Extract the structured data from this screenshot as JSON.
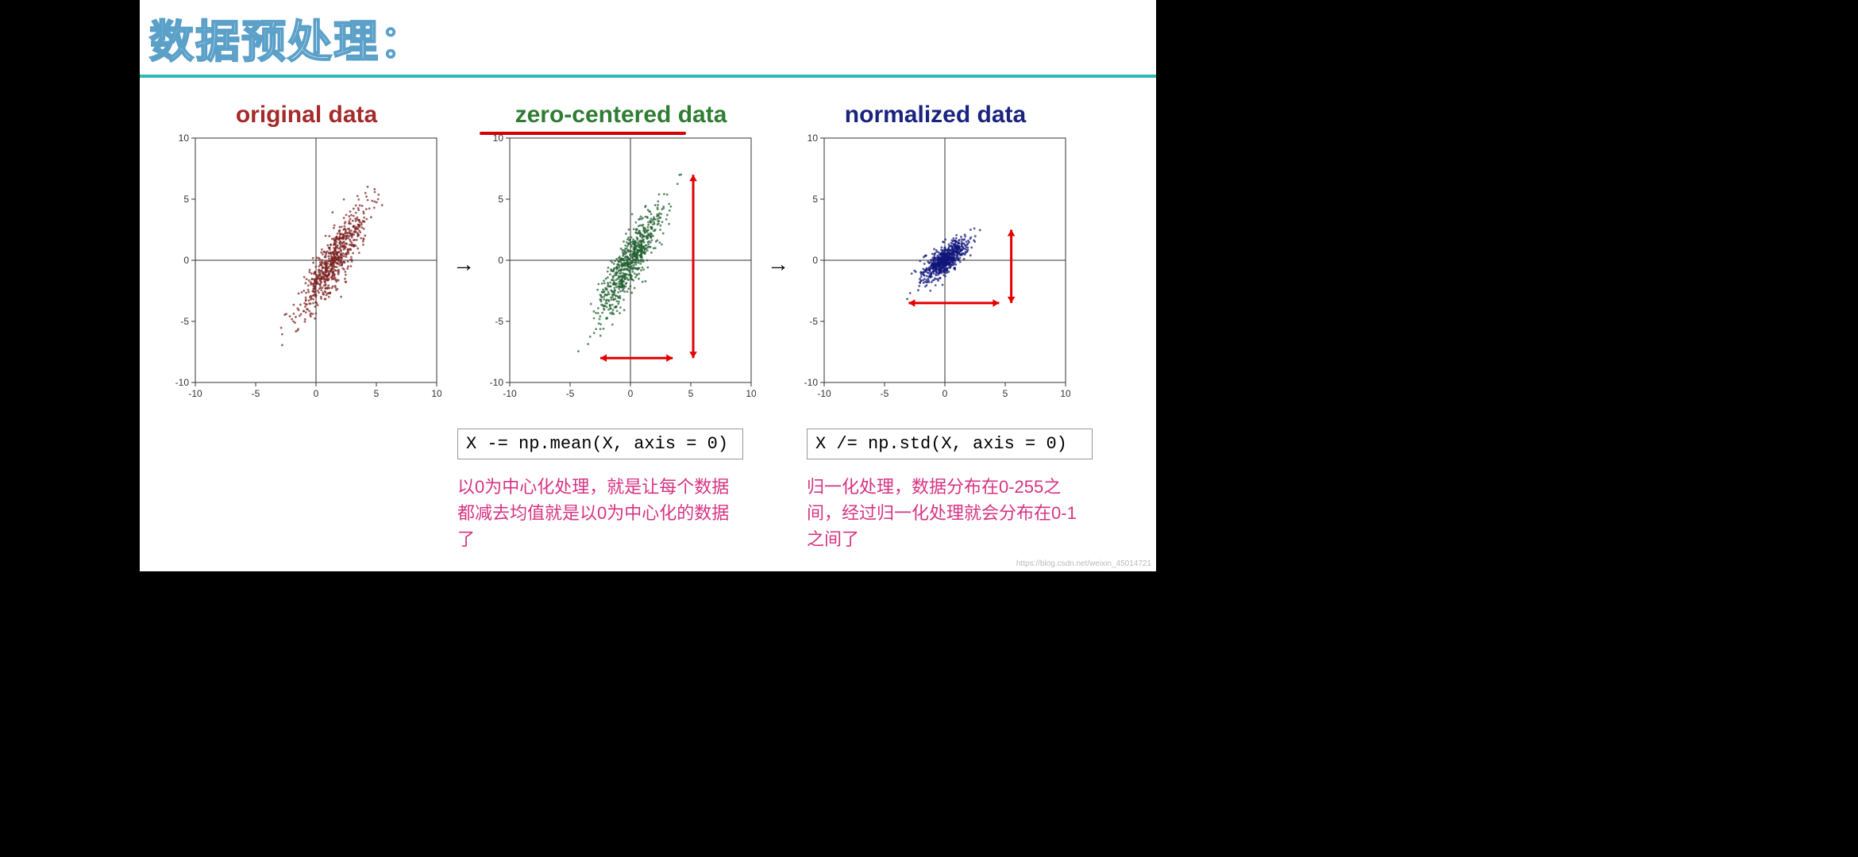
{
  "title": "数据预处理：",
  "watermark": "https://blog.csdn.net/weixin_45014721",
  "chart_data": [
    {
      "type": "scatter",
      "title": "original data",
      "color": "#7a1f1f",
      "xlabel": "",
      "ylabel": "",
      "xlim": [
        -10,
        10
      ],
      "ylim": [
        -10,
        10
      ],
      "xticks": [
        -10,
        -5,
        0,
        5,
        10
      ],
      "yticks": [
        -10,
        -5,
        0,
        5,
        10
      ],
      "cluster": {
        "cx": 1.5,
        "cy": 0,
        "angle_deg": 60,
        "spread_major": 5.0,
        "spread_minor": 1.2,
        "n": 700
      },
      "annotations": []
    },
    {
      "type": "scatter",
      "title": "zero-centered data",
      "color": "#1e5e2e",
      "xlabel": "",
      "ylabel": "",
      "xlim": [
        -10,
        10
      ],
      "ylim": [
        -10,
        10
      ],
      "xticks": [
        -10,
        -5,
        0,
        5,
        10
      ],
      "yticks": [
        -10,
        -5,
        0,
        5,
        10
      ],
      "cluster": {
        "cx": 0,
        "cy": 0,
        "angle_deg": 60,
        "spread_major": 5.0,
        "spread_minor": 1.2,
        "n": 700
      },
      "annotations": [
        {
          "kind": "double_arrow",
          "x1": -2.5,
          "y1": -8,
          "x2": 3.5,
          "y2": -8
        },
        {
          "kind": "double_arrow",
          "x1": 5.2,
          "y1": -8,
          "x2": 5.2,
          "y2": 7
        }
      ]
    },
    {
      "type": "scatter",
      "title": "normalized data",
      "color": "#10157a",
      "xlabel": "",
      "ylabel": "",
      "xlim": [
        -10,
        10
      ],
      "ylim": [
        -10,
        10
      ],
      "xticks": [
        -10,
        -5,
        0,
        5,
        10
      ],
      "yticks": [
        -10,
        -5,
        0,
        5,
        10
      ],
      "cluster": {
        "cx": 0,
        "cy": 0,
        "angle_deg": 40,
        "spread_major": 2.4,
        "spread_minor": 0.9,
        "n": 700
      },
      "annotations": [
        {
          "kind": "double_arrow",
          "x1": -3,
          "y1": -3.5,
          "x2": 4.5,
          "y2": -3.5
        },
        {
          "kind": "double_arrow",
          "x1": 5.5,
          "y1": -3.5,
          "x2": 5.5,
          "y2": 2.5
        }
      ]
    }
  ],
  "code": {
    "center": "X -= np.mean(X, axis = 0)",
    "norm": "X /= np.std(X, axis = 0)"
  },
  "notes": {
    "center": "以0为中心化处理，就是让每个数据都减去均值就是以0为中心化的数据了",
    "norm": "归一化处理，数据分布在0-255之间，经过归一化处理就会分布在0-1之间了"
  },
  "arrows_between": "→"
}
